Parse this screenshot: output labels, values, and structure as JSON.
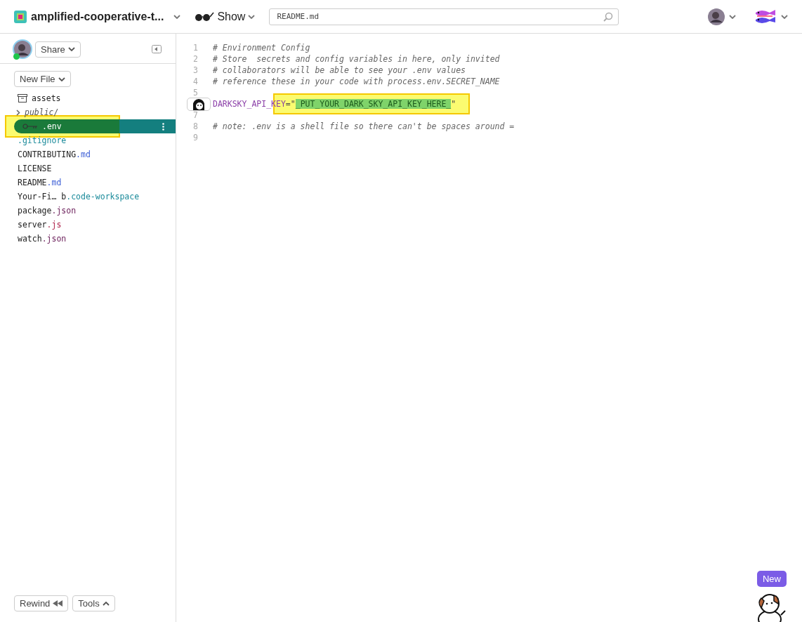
{
  "header": {
    "project": "amplified-cooperative-t...",
    "show": "Show",
    "search": {
      "value": "README.md"
    }
  },
  "sidebar": {
    "share": "Share",
    "new_file": "New File",
    "files": [
      {
        "kind": "archive",
        "name": "assets",
        "selected": false
      },
      {
        "kind": "folder",
        "name": "public/",
        "selected": false
      },
      {
        "kind": "env",
        "name": ".env",
        "selected": true
      },
      {
        "kind": "file",
        "ext": ".gitignore",
        "selected": false
      },
      {
        "kind": "file",
        "name": "CONTRIBUTING",
        "ext": ".md",
        "selected": false
      },
      {
        "kind": "file",
        "name": "LICENSE",
        "selected": false
      },
      {
        "kind": "file",
        "name": "README",
        "ext": ".md",
        "selected": false
      },
      {
        "kind": "file",
        "name": "Your-Fi… b",
        "ext": ".code-workspace",
        "selected": false
      },
      {
        "kind": "file",
        "name": "package",
        "ext": ".json",
        "selected": false
      },
      {
        "kind": "file",
        "name": "server",
        "ext": ".js",
        "selected": false
      },
      {
        "kind": "file",
        "name": "watch",
        "ext": ".json",
        "selected": false
      }
    ],
    "rewind": "Rewind",
    "tools": "Tools"
  },
  "editor": {
    "lines": [
      {
        "number": "1",
        "kind": "comment",
        "text": "# Environment Config"
      },
      {
        "number": "2",
        "kind": "comment",
        "text": "# Store  secrets and config variables in here, only invited"
      },
      {
        "number": "3",
        "kind": "comment",
        "text": "# collaborators will be able to see your .env values"
      },
      {
        "number": "4",
        "kind": "comment",
        "text": "# reference these in your code with process.env.SECRET_NAME"
      },
      {
        "number": "5",
        "kind": "blank"
      },
      {
        "kind": "assignment",
        "key": "DARKSKY_API_KEY",
        "operator": "=",
        "open_quote": "\"",
        "value": "_PUT_YOUR_DARK_SKY_API_KEY_HERE_",
        "close_quote": "\""
      },
      {
        "number": "7",
        "kind": "blank"
      },
      {
        "number": "8",
        "kind": "comment",
        "text": "# note: .env is a shell file so there can't be spaces around ="
      },
      {
        "number": "9",
        "kind": "blank"
      }
    ]
  },
  "new_badge": "New"
}
